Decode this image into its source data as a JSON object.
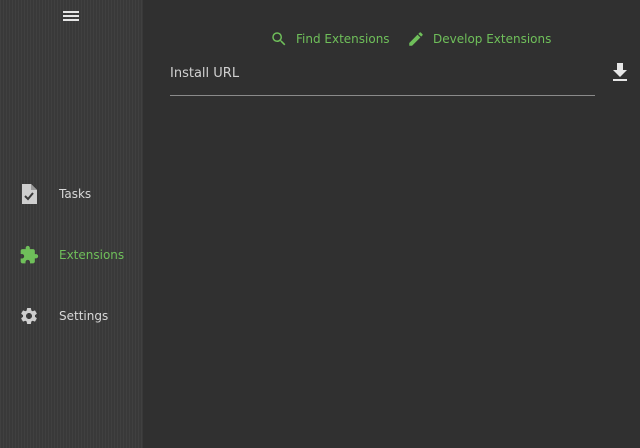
{
  "colors": {
    "accent": "#6fbf5a",
    "sidebar_bg": "#3b3b3b",
    "main_bg": "#303030",
    "text": "#d8d8d8"
  },
  "sidebar": {
    "menu_icon": "hamburger-menu-icon",
    "items": [
      {
        "label": "Tasks",
        "icon": "task-document-check-icon",
        "active": false
      },
      {
        "label": "Extensions",
        "icon": "puzzle-piece-icon",
        "active": true
      },
      {
        "label": "Settings",
        "icon": "gear-icon",
        "active": false
      }
    ]
  },
  "main": {
    "actions": [
      {
        "label": "Find Extensions",
        "icon": "search-icon"
      },
      {
        "label": "Develop Extensions",
        "icon": "pencil-icon"
      }
    ],
    "install": {
      "placeholder": "Install URL",
      "value": "",
      "button_icon": "download-icon"
    }
  }
}
